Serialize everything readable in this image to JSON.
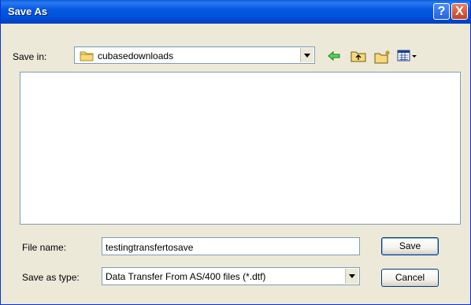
{
  "window": {
    "title": "Save As",
    "help_symbol": "?",
    "close_symbol": "X"
  },
  "save_in": {
    "label": "Save in:",
    "value": "cubasedownloads"
  },
  "toolbar": {
    "icons": [
      "back-arrow-icon",
      "up-folder-icon",
      "new-folder-icon",
      "view-menu-icon"
    ]
  },
  "file_name": {
    "label": "File name:",
    "value": "testingtransfertosave"
  },
  "save_as_type": {
    "label": "Save as type:",
    "value": "Data Transfer From AS/400 files (*.dtf)"
  },
  "buttons": {
    "save": "Save",
    "cancel": "Cancel"
  },
  "colors": {
    "titlebar": "#0151d9",
    "dialog_bg": "#ece9d8",
    "close": "#c6401f"
  }
}
